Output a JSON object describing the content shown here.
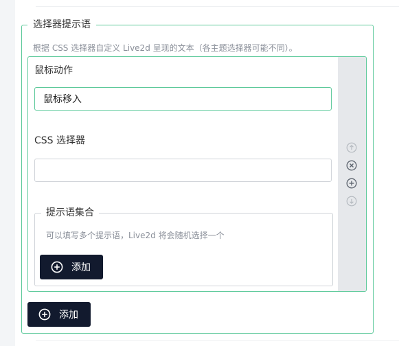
{
  "selector_tips": {
    "legend": "选择器提示语",
    "description": "根据 CSS 选择器自定义 Live2d 呈现的文本（各主题选择器可能不同）。",
    "item": {
      "mouse_action_label": "鼠标动作",
      "mouse_action_value": "鼠标移入",
      "css_selector_label": "CSS 选择器",
      "css_selector_value": "",
      "tips_group": {
        "legend": "提示语集合",
        "description": "可以填写多个提示语，Live2d 将会随机选择一个",
        "add_label": "添加"
      }
    },
    "add_label": "添加"
  },
  "item_controls": [
    {
      "name": "move-up",
      "icon": "arrow-up-circle-icon",
      "disabled": true
    },
    {
      "name": "remove",
      "icon": "close-circle-icon",
      "disabled": false
    },
    {
      "name": "add",
      "icon": "plus-circle-icon",
      "disabled": false
    },
    {
      "name": "move-down",
      "icon": "arrow-down-circle-icon",
      "disabled": true
    }
  ],
  "colors": {
    "accent_border": "#5cc99a",
    "button_bg": "#121a2e",
    "controls_bg": "#e6e8eb",
    "icon_active": "#5f6670",
    "icon_disabled": "#b4b9bf"
  }
}
